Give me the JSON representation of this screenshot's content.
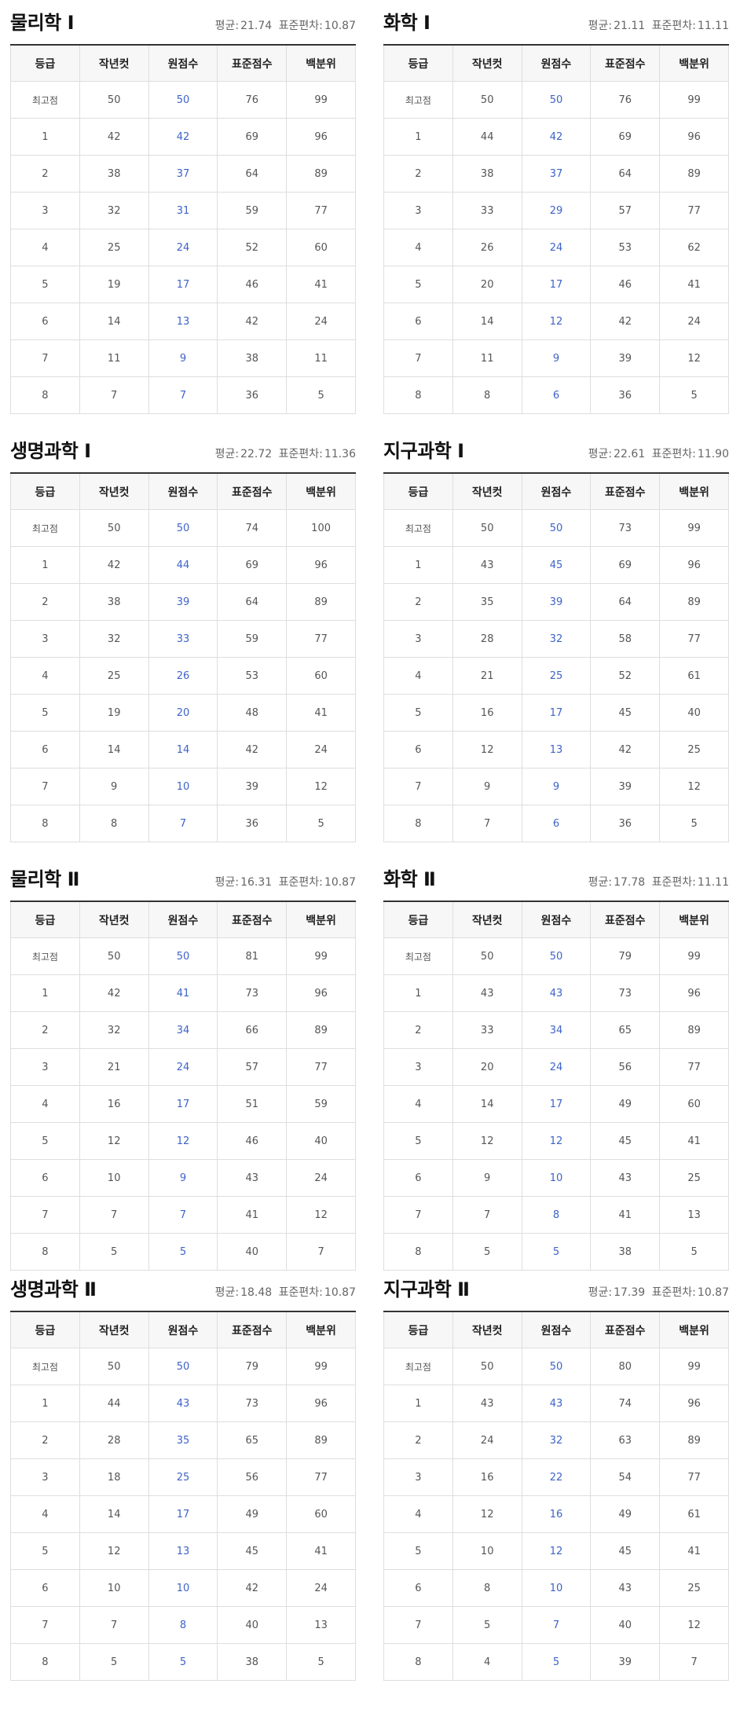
{
  "headers": [
    "등급",
    "작년컷",
    "원점수",
    "표준점수",
    "백분위"
  ],
  "stats_labels": {
    "mean": "평균:",
    "sd": "표준편차:"
  },
  "subjects": [
    {
      "title": "물리학 Ⅰ",
      "mean": "21.74",
      "sd": "10.87",
      "rows": [
        [
          "최고점",
          "50",
          "50",
          "76",
          "99"
        ],
        [
          "1",
          "42",
          "42",
          "69",
          "96"
        ],
        [
          "2",
          "38",
          "37",
          "64",
          "89"
        ],
        [
          "3",
          "32",
          "31",
          "59",
          "77"
        ],
        [
          "4",
          "25",
          "24",
          "52",
          "60"
        ],
        [
          "5",
          "19",
          "17",
          "46",
          "41"
        ],
        [
          "6",
          "14",
          "13",
          "42",
          "24"
        ],
        [
          "7",
          "11",
          "9",
          "38",
          "11"
        ],
        [
          "8",
          "7",
          "7",
          "36",
          "5"
        ]
      ]
    },
    {
      "title": "화학 Ⅰ",
      "mean": "21.11",
      "sd": "11.11",
      "rows": [
        [
          "최고점",
          "50",
          "50",
          "76",
          "99"
        ],
        [
          "1",
          "44",
          "42",
          "69",
          "96"
        ],
        [
          "2",
          "38",
          "37",
          "64",
          "89"
        ],
        [
          "3",
          "33",
          "29",
          "57",
          "77"
        ],
        [
          "4",
          "26",
          "24",
          "53",
          "62"
        ],
        [
          "5",
          "20",
          "17",
          "46",
          "41"
        ],
        [
          "6",
          "14",
          "12",
          "42",
          "24"
        ],
        [
          "7",
          "11",
          "9",
          "39",
          "12"
        ],
        [
          "8",
          "8",
          "6",
          "36",
          "5"
        ]
      ]
    },
    {
      "title": "생명과학 Ⅰ",
      "mean": "22.72",
      "sd": "11.36",
      "rows": [
        [
          "최고점",
          "50",
          "50",
          "74",
          "100"
        ],
        [
          "1",
          "42",
          "44",
          "69",
          "96"
        ],
        [
          "2",
          "38",
          "39",
          "64",
          "89"
        ],
        [
          "3",
          "32",
          "33",
          "59",
          "77"
        ],
        [
          "4",
          "25",
          "26",
          "53",
          "60"
        ],
        [
          "5",
          "19",
          "20",
          "48",
          "41"
        ],
        [
          "6",
          "14",
          "14",
          "42",
          "24"
        ],
        [
          "7",
          "9",
          "10",
          "39",
          "12"
        ],
        [
          "8",
          "8",
          "7",
          "36",
          "5"
        ]
      ]
    },
    {
      "title": "지구과학 Ⅰ",
      "mean": "22.61",
      "sd": "11.90",
      "rows": [
        [
          "최고점",
          "50",
          "50",
          "73",
          "99"
        ],
        [
          "1",
          "43",
          "45",
          "69",
          "96"
        ],
        [
          "2",
          "35",
          "39",
          "64",
          "89"
        ],
        [
          "3",
          "28",
          "32",
          "58",
          "77"
        ],
        [
          "4",
          "21",
          "25",
          "52",
          "61"
        ],
        [
          "5",
          "16",
          "17",
          "45",
          "40"
        ],
        [
          "6",
          "12",
          "13",
          "42",
          "25"
        ],
        [
          "7",
          "9",
          "9",
          "39",
          "12"
        ],
        [
          "8",
          "7",
          "6",
          "36",
          "5"
        ]
      ]
    },
    {
      "title": "물리학 Ⅱ",
      "mean": "16.31",
      "sd": "10.87",
      "rows": [
        [
          "최고점",
          "50",
          "50",
          "81",
          "99"
        ],
        [
          "1",
          "42",
          "41",
          "73",
          "96"
        ],
        [
          "2",
          "32",
          "34",
          "66",
          "89"
        ],
        [
          "3",
          "21",
          "24",
          "57",
          "77"
        ],
        [
          "4",
          "16",
          "17",
          "51",
          "59"
        ],
        [
          "5",
          "12",
          "12",
          "46",
          "40"
        ],
        [
          "6",
          "10",
          "9",
          "43",
          "24"
        ],
        [
          "7",
          "7",
          "7",
          "41",
          "12"
        ],
        [
          "8",
          "5",
          "5",
          "40",
          "7"
        ]
      ]
    },
    {
      "title": "화학 Ⅱ",
      "mean": "17.78",
      "sd": "11.11",
      "rows": [
        [
          "최고점",
          "50",
          "50",
          "79",
          "99"
        ],
        [
          "1",
          "43",
          "43",
          "73",
          "96"
        ],
        [
          "2",
          "33",
          "34",
          "65",
          "89"
        ],
        [
          "3",
          "20",
          "24",
          "56",
          "77"
        ],
        [
          "4",
          "14",
          "17",
          "49",
          "60"
        ],
        [
          "5",
          "12",
          "12",
          "45",
          "41"
        ],
        [
          "6",
          "9",
          "10",
          "43",
          "25"
        ],
        [
          "7",
          "7",
          "8",
          "41",
          "13"
        ],
        [
          "8",
          "5",
          "5",
          "38",
          "5"
        ]
      ]
    },
    {
      "title": "생명과학 Ⅱ",
      "mean": "18.48",
      "sd": "10.87",
      "rows": [
        [
          "최고점",
          "50",
          "50",
          "79",
          "99"
        ],
        [
          "1",
          "44",
          "43",
          "73",
          "96"
        ],
        [
          "2",
          "28",
          "35",
          "65",
          "89"
        ],
        [
          "3",
          "18",
          "25",
          "56",
          "77"
        ],
        [
          "4",
          "14",
          "17",
          "49",
          "60"
        ],
        [
          "5",
          "12",
          "13",
          "45",
          "41"
        ],
        [
          "6",
          "10",
          "10",
          "42",
          "24"
        ],
        [
          "7",
          "7",
          "8",
          "40",
          "13"
        ],
        [
          "8",
          "5",
          "5",
          "38",
          "5"
        ]
      ]
    },
    {
      "title": "지구과학 Ⅱ",
      "mean": "17.39",
      "sd": "10.87",
      "rows": [
        [
          "최고점",
          "50",
          "50",
          "80",
          "99"
        ],
        [
          "1",
          "43",
          "43",
          "74",
          "96"
        ],
        [
          "2",
          "24",
          "32",
          "63",
          "89"
        ],
        [
          "3",
          "16",
          "22",
          "54",
          "77"
        ],
        [
          "4",
          "12",
          "16",
          "49",
          "61"
        ],
        [
          "5",
          "10",
          "12",
          "45",
          "41"
        ],
        [
          "6",
          "8",
          "10",
          "43",
          "25"
        ],
        [
          "7",
          "5",
          "7",
          "40",
          "12"
        ],
        [
          "8",
          "4",
          "5",
          "39",
          "7"
        ]
      ]
    }
  ]
}
